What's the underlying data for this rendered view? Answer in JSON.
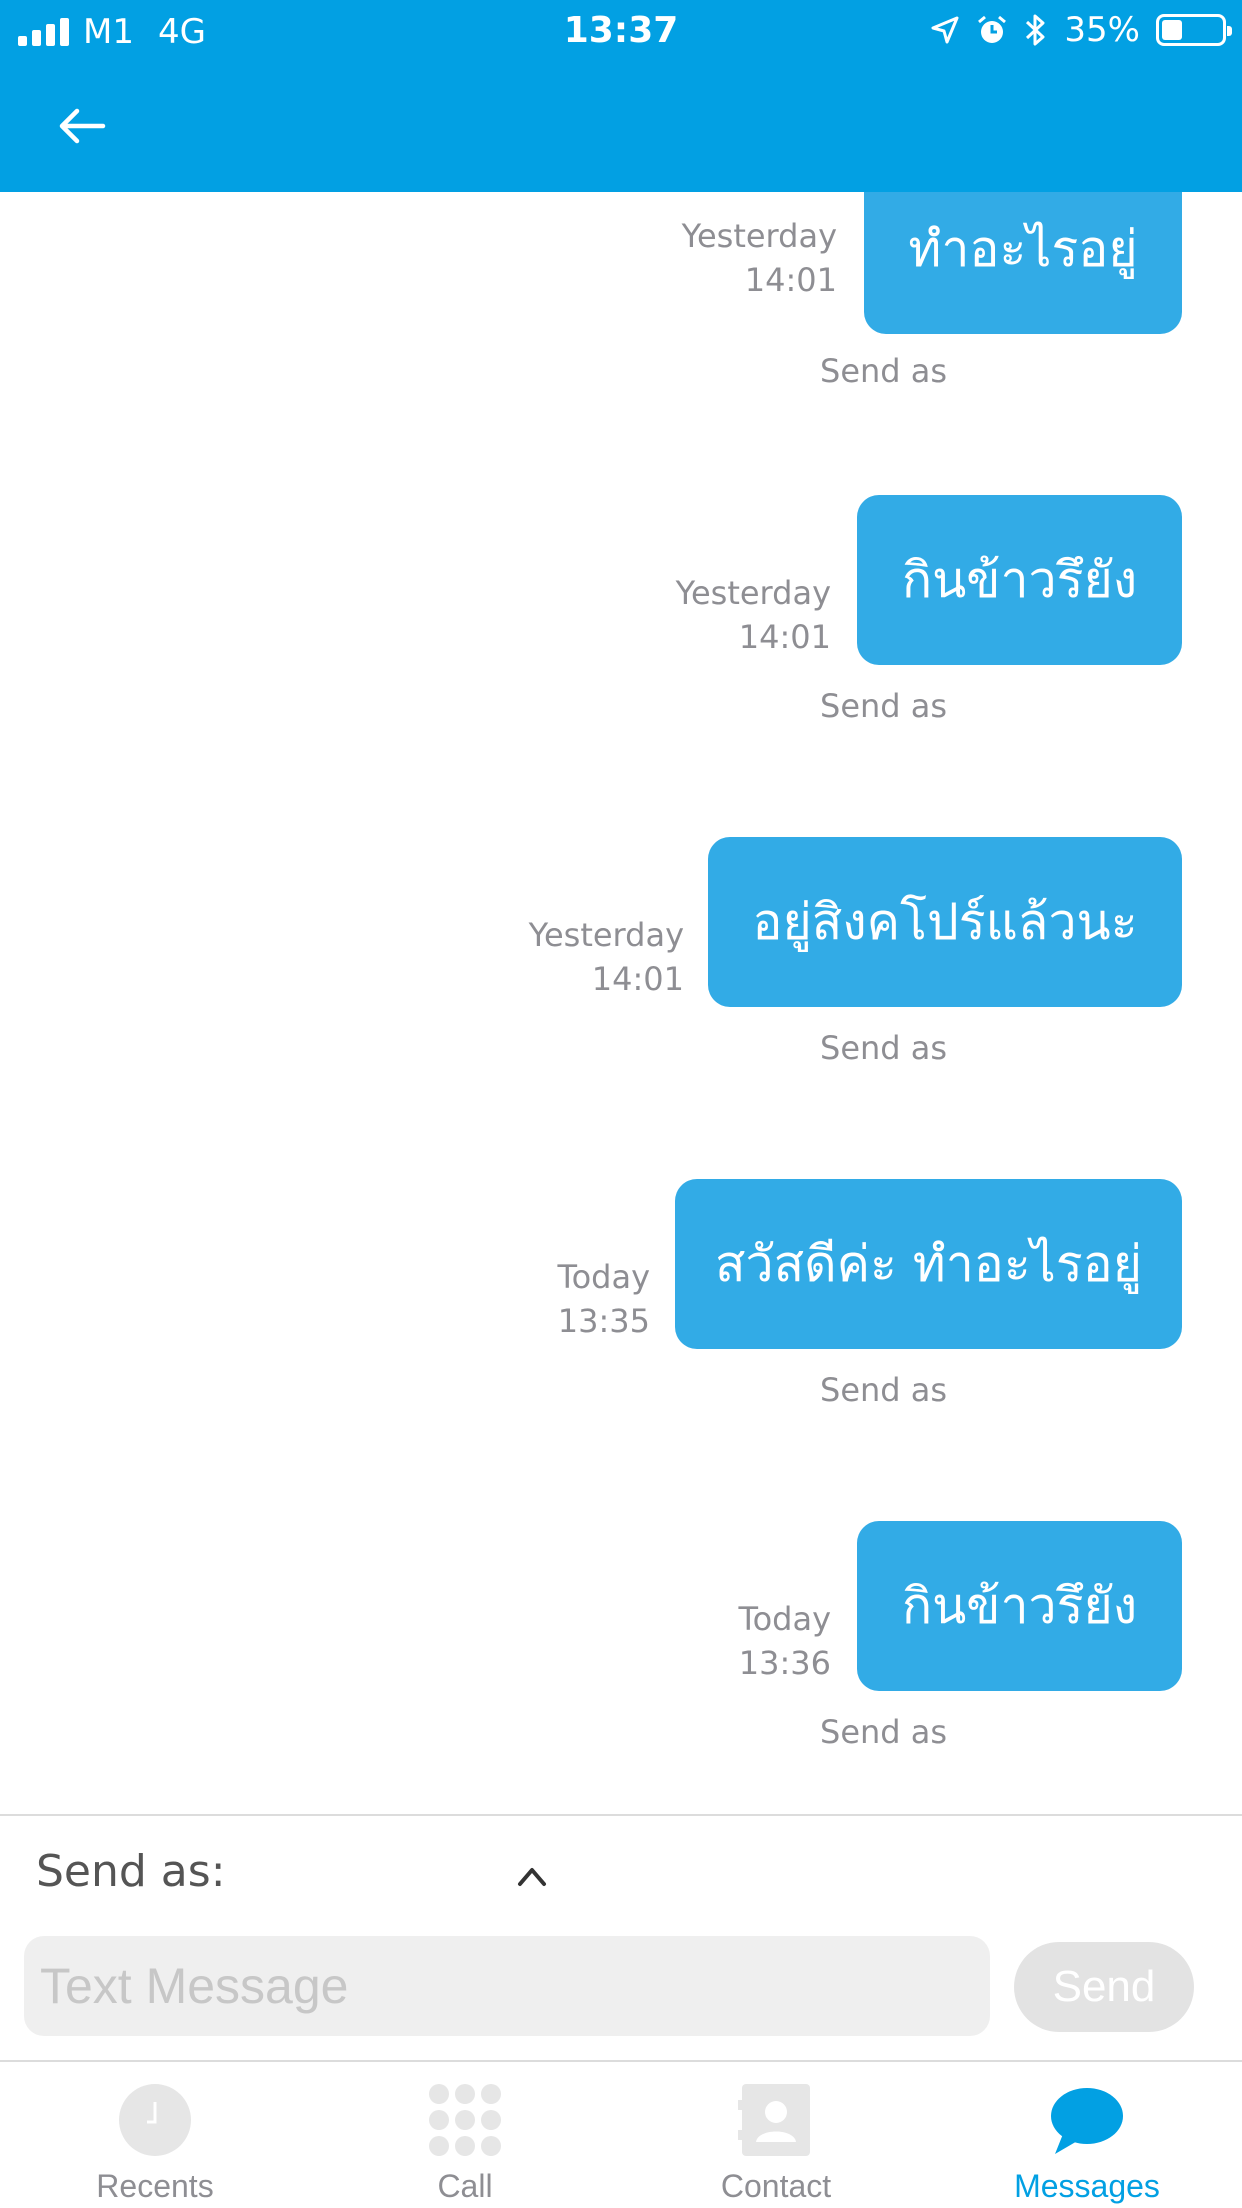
{
  "status_bar": {
    "carrier": "M1",
    "network": "4G",
    "time": "13:37",
    "battery": "35%",
    "battery_level": 0.35
  },
  "header": {
    "back_icon": "arrow-left-icon"
  },
  "messages": [
    {
      "text": "ทำอะไรอยู่",
      "day": "Yesterday",
      "time": "14:01",
      "send_as": "Send as"
    },
    {
      "text": "กินข้าวรึยัง",
      "day": "Yesterday",
      "time": "14:01",
      "send_as": "Send as"
    },
    {
      "text": "อยู่สิงคโปร์แล้วนะ",
      "day": "Yesterday",
      "time": "14:01",
      "send_as": "Send as"
    },
    {
      "text": "สวัสดีค่ะ ทำอะไรอยู่",
      "day": "Today",
      "time": "13:35",
      "send_as": "Send as"
    },
    {
      "text": "กินข้าวรึยัง",
      "day": "Today",
      "time": "13:36",
      "send_as": "Send as"
    }
  ],
  "composer": {
    "send_as_label": "Send as:",
    "input_placeholder": "Text Message",
    "send_label": "Send"
  },
  "tabs": [
    {
      "label": "Recents",
      "icon": "clock-icon",
      "active": false
    },
    {
      "label": "Call",
      "icon": "keypad-icon",
      "active": false
    },
    {
      "label": "Contact",
      "icon": "contact-card-icon",
      "active": false
    },
    {
      "label": "Messages",
      "icon": "chat-bubble-icon",
      "active": true
    }
  ],
  "colors": {
    "accent": "#02a0e3",
    "bubble": "#32abe6",
    "muted_text": "#8e8e93"
  }
}
